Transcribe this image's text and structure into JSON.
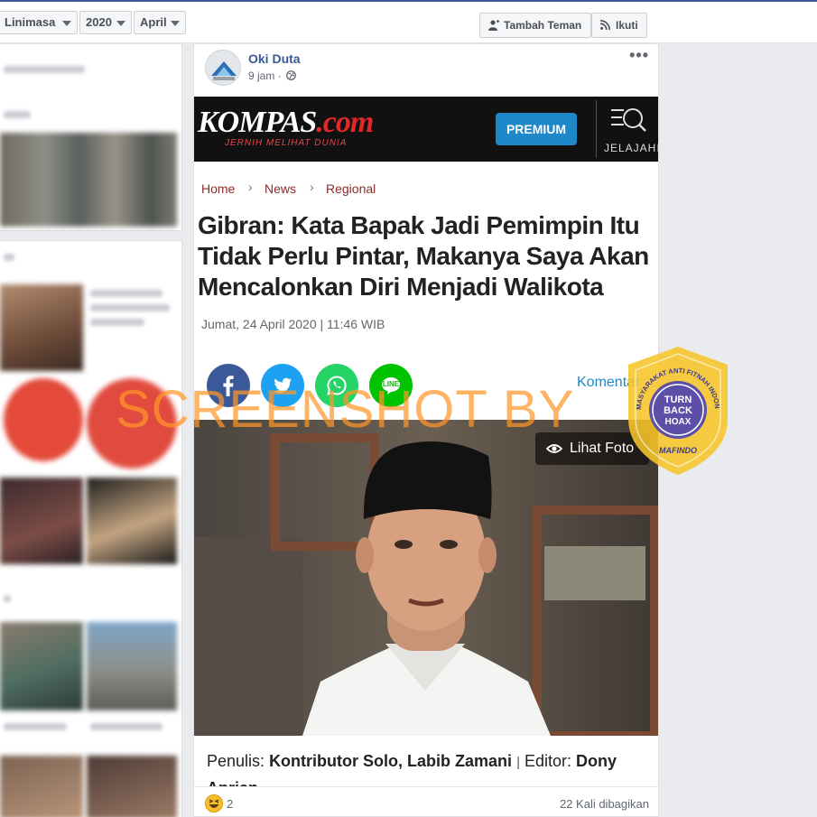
{
  "filters": {
    "dropdown_1": "Linimasa",
    "dropdown_2": "2020",
    "dropdown_3": "April"
  },
  "actions": {
    "add_friend": "Tambah Teman",
    "follow": "Ikuti"
  },
  "post": {
    "author": "Oki Duta",
    "time": "9 jam ·",
    "more": "•••"
  },
  "article": {
    "brand_main": "KOMPAS",
    "brand_dot": ".com",
    "tagline": "JERNIH MELIHAT DUNIA",
    "premium": "PREMIUM",
    "explore": "JELAJAHI",
    "breadcrumb": [
      "Home",
      "News",
      "Regional"
    ],
    "headline": "Gibran: Kata Bapak Jadi Pemimpin Itu Tidak Perlu Pintar, Makanya Saya Akan Mencalonkan Diri Menjadi Walikota",
    "date": "Jumat, 24 April 2020 | 11:46 WIB",
    "comment": "Komentar",
    "view_photo": "Lihat Foto",
    "author_label": "Penulis:",
    "author_value": "Kontributor Solo, Labib Zamani",
    "editor_label": "Editor:",
    "editor_value": "Dony Aprian",
    "share_line": "LINE"
  },
  "footer": {
    "reaction_count": "2",
    "share_count": "22 Kali dibagikan"
  },
  "overlay": {
    "watermark": "SCREENSHOT BY",
    "badge_line_1": "TURN",
    "badge_line_2": "BACK",
    "badge_line_3": "HOAX",
    "badge_ring": "MASYARAKAT ANTI FITNAH INDONESIA",
    "badge_org": "MAFINDO"
  },
  "colors": {
    "facebook_blue": "#3b5998",
    "link": "#385898",
    "kompas_red": "#e32726",
    "premium_blue": "#1e88c9",
    "breadcrumb": "#8b2b2b"
  },
  "icons": [
    "person-add-icon",
    "rss-icon",
    "globe-icon",
    "search-menu-icon",
    "facebook-icon",
    "twitter-icon",
    "whatsapp-icon",
    "line-icon",
    "eye-icon",
    "laugh-reaction-icon"
  ]
}
